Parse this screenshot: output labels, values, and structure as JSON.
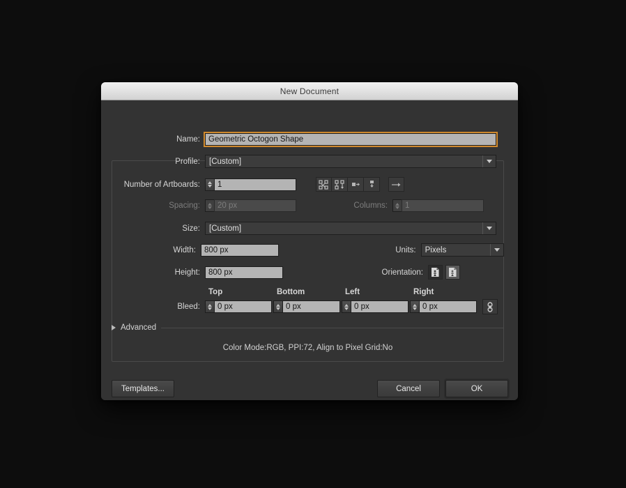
{
  "window": {
    "title": "New Document"
  },
  "form": {
    "name": {
      "label": "Name:",
      "value": "Geometric Octogon Shape"
    },
    "profile": {
      "label": "Profile:",
      "value": "[Custom]"
    },
    "artboards": {
      "label": "Number of Artboards:",
      "value": "1",
      "icons": [
        "grid-by-row-icon",
        "grid-by-column-icon",
        "arrange-right-icon",
        "arrange-down-icon",
        "flow-direction-icon"
      ]
    },
    "spacing": {
      "label": "Spacing:",
      "value": "20 px"
    },
    "columns": {
      "label": "Columns:",
      "value": "1"
    },
    "size": {
      "label": "Size:",
      "value": "[Custom]"
    },
    "width": {
      "label": "Width:",
      "value": "800 px"
    },
    "height": {
      "label": "Height:",
      "value": "800 px"
    },
    "units": {
      "label": "Units:",
      "value": "Pixels"
    },
    "orientation": {
      "label": "Orientation:",
      "portrait_icon": "portrait-orientation-icon",
      "landscape_icon": "landscape-orientation-icon"
    },
    "bleed": {
      "label": "Bleed:",
      "top_header": "Top",
      "bottom_header": "Bottom",
      "left_header": "Left",
      "right_header": "Right",
      "top": "0 px",
      "bottom": "0 px",
      "left": "0 px",
      "right": "0 px",
      "link_icon": "chain-link-icon"
    },
    "advanced": {
      "label": "Advanced",
      "disclosure_icon": "triangle-right-icon"
    },
    "summary": "Color Mode:RGB, PPI:72, Align to Pixel Grid:No"
  },
  "footer": {
    "templates": "Templates...",
    "cancel": "Cancel",
    "ok": "OK"
  },
  "colors": {
    "dialog_bg": "#333333",
    "focus_accent": "#d08a2e",
    "field_bg": "#b4b4b4",
    "titlebar_top": "#efefef"
  }
}
